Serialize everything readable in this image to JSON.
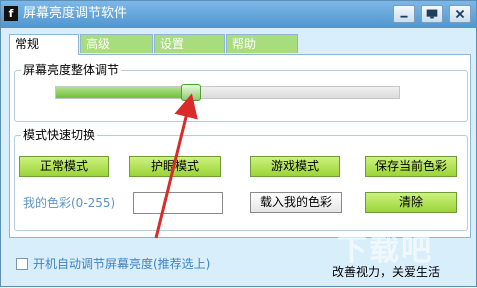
{
  "window": {
    "app_icon_letter": "f",
    "title": "屏幕亮度调节软件"
  },
  "tabs": [
    {
      "label": "常规",
      "active": true
    },
    {
      "label": "高级",
      "active": false
    },
    {
      "label": "设置",
      "active": false
    },
    {
      "label": "帮助",
      "active": false
    }
  ],
  "brightness": {
    "group_title": "屏幕亮度整体调节",
    "level_fraction": 0.395
  },
  "modes": {
    "group_title": "模式快速切换",
    "buttons": {
      "normal": "正常模式",
      "eye_care": "护眼模式",
      "game": "游戏模式",
      "save_color": "保存当前色彩",
      "load_color": "载入我的色彩",
      "clear": "清除"
    },
    "my_color_label": "我的色彩(0-255)",
    "my_color_value": ""
  },
  "footer": {
    "autostart_label": "开机自动调节屏幕亮度(推荐选上)",
    "autostart_checked": false,
    "slogan": "改善视力，关爱生活"
  },
  "watermark": "下载吧",
  "colors": {
    "accent_green": "#9bd437",
    "tab_inactive": "#a7dd7d",
    "window_bg": "#d9eefb",
    "annotation_arrow": "#d92b2b"
  },
  "icons": {
    "minimize": "minimize-icon",
    "restore": "restore-icon",
    "close": "close-icon",
    "annotation": "red-arrow-annotation"
  }
}
